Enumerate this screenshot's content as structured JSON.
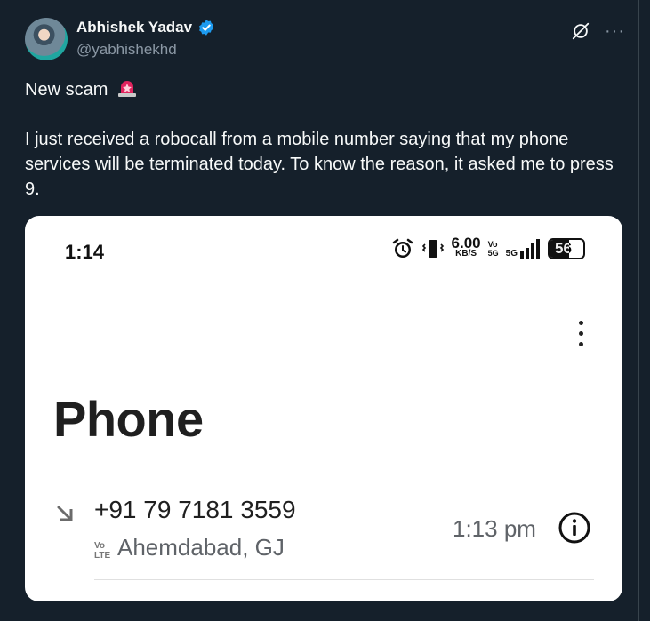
{
  "author": {
    "name": "Abhishek Yadav",
    "handle": "@yabhishekhd",
    "verified": true
  },
  "header_icons": {
    "grok": "grok-icon",
    "more": "···"
  },
  "tweet": {
    "line1": "New scam",
    "line1_emoji": "siren-icon",
    "body": "I just received a robocall from a mobile number saying that my phone services will be terminated today. To know the reason, it asked me to press 9."
  },
  "media": {
    "status_bar": {
      "time": "1:14",
      "speed_value": "6.00",
      "speed_unit": "KB/S",
      "vo_top": "Vo",
      "vo_bottom": "5G",
      "network": "5G",
      "battery": "56"
    },
    "app_title": "Phone",
    "call": {
      "number": "+91 79 7181 3559",
      "badge_top": "Vo",
      "badge_bottom": "LTE",
      "location": "Ahemdabad, GJ",
      "time": "1:13 pm"
    }
  },
  "colors": {
    "background": "#15202b",
    "verified": "#1d9bf0",
    "muted": "#8b98a5"
  }
}
